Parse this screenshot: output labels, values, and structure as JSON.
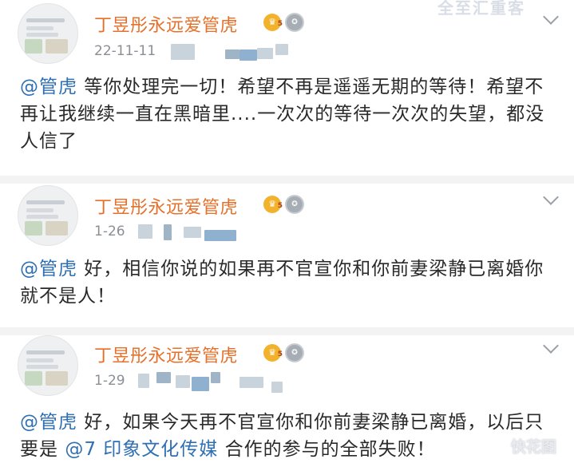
{
  "watermark_top": "全至汇重客",
  "watermark_bottom": "快花图",
  "posts": [
    {
      "username": "丁昱彤永远爱管虎",
      "badge_level": "5",
      "date": "22-11-11",
      "mention": "@管虎",
      "text": " 等你处理完一切！希望不再是遥遥无期的等待！希望不再让我继续一直在黑暗里....一次次的等待一次次的失望，都没人信了"
    },
    {
      "username": "丁昱彤永远爱管虎",
      "badge_level": "5",
      "date": "1-26",
      "mention": "@管虎",
      "text": " 好，相信你说的如果再不官宣你和你前妻梁静已离婚你就不是人！"
    },
    {
      "username": "丁昱彤永远爱管虎",
      "badge_level": "5",
      "date": "1-29",
      "mention": "@管虎",
      "text": " 好，如果今天再不官宣你和你前妻梁静已离婚，以后只要是 ",
      "mention2": "@7 印象文化传媒",
      "text2": " 合作的参与的全部失败！"
    }
  ],
  "colors": {
    "username": "#e6702a",
    "mention": "#2f6fb3",
    "timestamp": "#8a8f96"
  },
  "icons": [
    "avatar",
    "crown-badge-icon",
    "medal-badge-icon",
    "chevron-down-icon"
  ]
}
